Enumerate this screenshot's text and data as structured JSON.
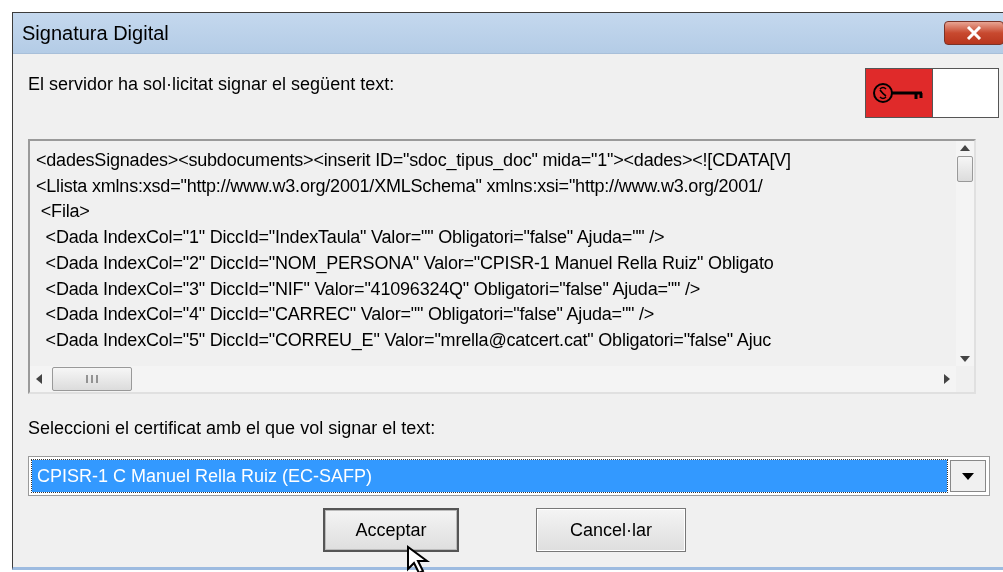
{
  "window": {
    "title": "Signatura Digital"
  },
  "prompt": "El servidor ha sol·licitat signar el següent text:",
  "document_lines": [
    "<dadesSignades><subdocuments><inserit ID=\"sdoc_tipus_doc\" mida=\"1\"><dades><![CDATA[V]",
    "<Llista xmlns:xsd=\"http://www.w3.org/2001/XMLSchema\" xmlns:xsi=\"http://www.w3.org/2001/",
    " <Fila>",
    "  <Dada IndexCol=\"1\" DiccId=\"IndexTaula\" Valor=\"\" Obligatori=\"false\" Ajuda=\"\" />",
    "  <Dada IndexCol=\"2\" DiccId=\"NOM_PERSONA\" Valor=\"CPISR-1 Manuel Rella Ruiz\" Obligato",
    "  <Dada IndexCol=\"3\" DiccId=\"NIF\" Valor=\"41096324Q\" Obligatori=\"false\" Ajuda=\"\" />",
    "  <Dada IndexCol=\"4\" DiccId=\"CARREC\" Valor=\"\" Obligatori=\"false\" Ajuda=\"\" />",
    "  <Dada IndexCol=\"5\" DiccId=\"CORREU_E\" Valor=\"mrella@catcert.cat\" Obligatori=\"false\" Ajuc"
  ],
  "certificate_label": "Seleccioni el certificat amb el que vol signar el text:",
  "certificate_select": {
    "value": "CPISR-1 C Manuel Rella Ruiz (EC-SAFP)"
  },
  "buttons": [
    {
      "label": "Acceptar",
      "focused": true
    },
    {
      "label": "Cancel·lar",
      "focused": false
    }
  ]
}
